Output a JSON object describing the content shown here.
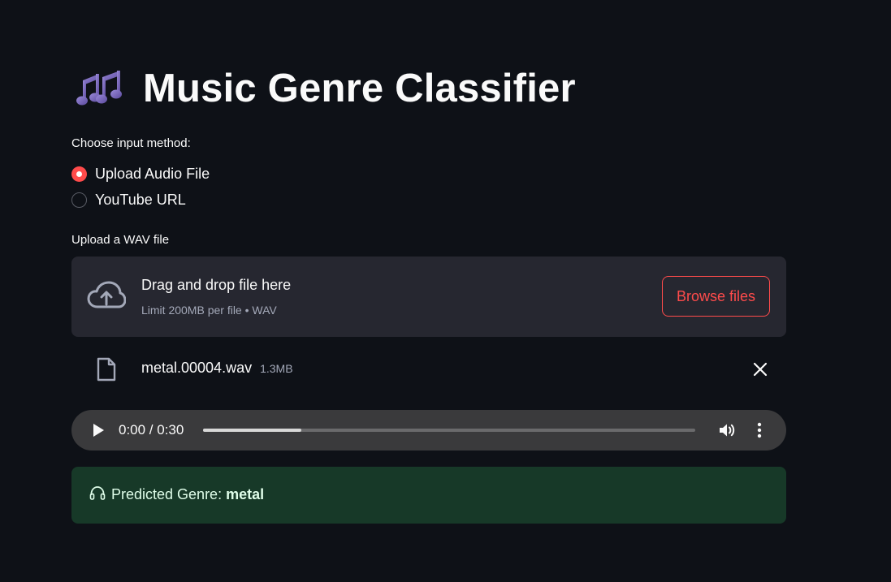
{
  "header": {
    "title": "Music Genre Classifier",
    "icon": "musical-notes-icon"
  },
  "input_method": {
    "label": "Choose input method:",
    "options": [
      {
        "label": "Upload Audio File",
        "selected": true
      },
      {
        "label": "YouTube URL",
        "selected": false
      }
    ]
  },
  "uploader": {
    "label": "Upload a WAV file",
    "drop_title": "Drag and drop file here",
    "drop_subtitle": "Limit 200MB per file • WAV",
    "browse_label": "Browse files",
    "file": {
      "name": "metal.00004.wav",
      "size": "1.3MB"
    }
  },
  "player": {
    "time": "0:00 / 0:30",
    "progress": 0.2
  },
  "result": {
    "icon": "headphones-icon",
    "prefix": "Predicted Genre:",
    "value": "metal"
  },
  "colors": {
    "accent": "#ff4b4b",
    "success_bg": "#173928",
    "background": "#0e1117"
  }
}
